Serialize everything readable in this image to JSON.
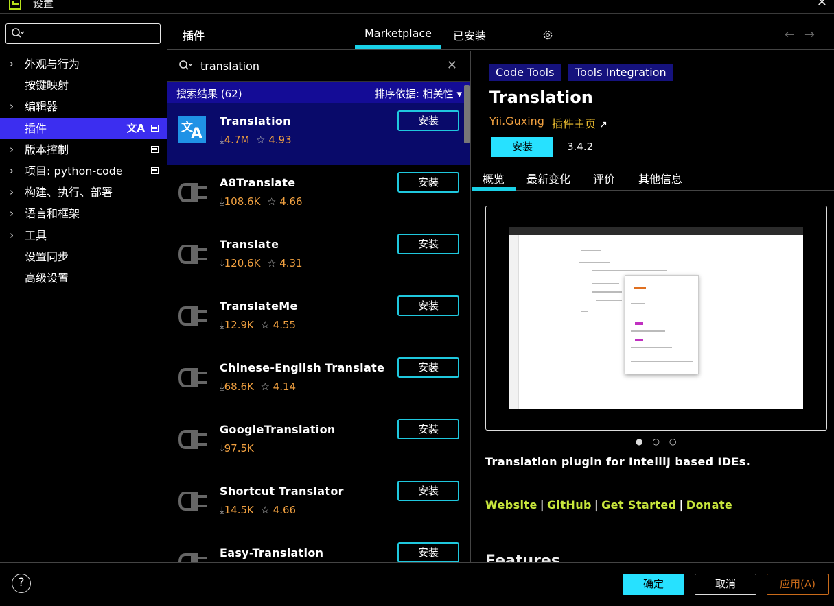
{
  "window": {
    "title": "设置"
  },
  "sidebar": {
    "items": [
      {
        "label": "外观与行为",
        "expandable": true
      },
      {
        "label": "按键映射",
        "expandable": false
      },
      {
        "label": "编辑器",
        "expandable": true
      },
      {
        "label": "插件",
        "expandable": false,
        "active": true
      },
      {
        "label": "版本控制",
        "expandable": true
      },
      {
        "label": "项目: python-code",
        "expandable": true
      },
      {
        "label": "构建、执行、部署",
        "expandable": true
      },
      {
        "label": "语言和框架",
        "expandable": true
      },
      {
        "label": "工具",
        "expandable": true
      },
      {
        "label": "设置同步",
        "expandable": false
      },
      {
        "label": "高级设置",
        "expandable": false
      }
    ]
  },
  "header": {
    "title": "插件",
    "tab_marketplace": "Marketplace",
    "tab_installed": "已安装",
    "back_icon": "←",
    "forward_icon": "→"
  },
  "list": {
    "query": "translation",
    "results_label": "搜索结果 (62)",
    "sort_label": "排序依据: 相关性",
    "install_label": "安装",
    "plugins": [
      {
        "name": "Translation",
        "downloads": "4.7M",
        "rating": "4.93",
        "icon": "translation-icon",
        "selected": true
      },
      {
        "name": "A8Translate",
        "downloads": "108.6K",
        "rating": "4.66",
        "icon": "plug-icon"
      },
      {
        "name": "Translate",
        "downloads": "120.6K",
        "rating": "4.31",
        "icon": "plug-icon"
      },
      {
        "name": "TranslateMe",
        "downloads": "12.9K",
        "rating": "4.55",
        "icon": "plug-icon"
      },
      {
        "name": "Chinese-English Translate",
        "downloads": "68.6K",
        "rating": "4.14",
        "icon": "plug-icon"
      },
      {
        "name": "GoogleTranslation",
        "downloads": "97.5K",
        "rating": "",
        "icon": "plug-icon"
      },
      {
        "name": "Shortcut Translator",
        "downloads": "14.5K",
        "rating": "4.66",
        "icon": "plug-icon"
      },
      {
        "name": "Easy-Translation",
        "downloads": "",
        "rating": "",
        "icon": "plug-icon"
      }
    ]
  },
  "detail": {
    "tags": [
      "Code Tools",
      "Tools Integration"
    ],
    "name": "Translation",
    "vendor": "Yii.Guxing",
    "homepage": "插件主页",
    "install_label": "安装",
    "version": "3.4.2",
    "tabs": [
      "概览",
      "最新变化",
      "评价",
      "其他信息"
    ],
    "description": "Translation plugin for IntelliJ based IDEs.",
    "links": [
      "Website",
      "GitHub",
      "Get Started",
      "Donate"
    ],
    "features_heading": "Features"
  },
  "footer": {
    "ok_label": "确定",
    "cancel_label": "取消",
    "apply_label": "应用(A)",
    "help_label": "?"
  },
  "colors": {
    "accent": "#19d0e6",
    "selection": "#3c2ef0",
    "rating": "#f0a040",
    "link": "#c8e63c"
  }
}
